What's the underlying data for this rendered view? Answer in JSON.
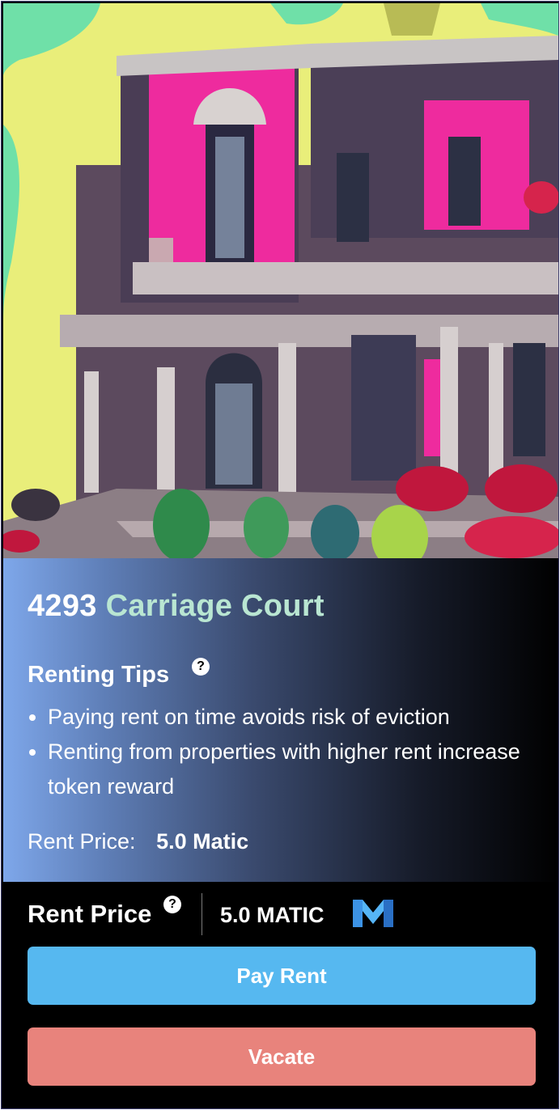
{
  "property": {
    "address_number": "4293",
    "address_street": "Carriage Court",
    "image_icon": "victorian-house-illustration"
  },
  "tips": {
    "title": "Renting Tips",
    "help_glyph": "?",
    "items": [
      "Paying rent on time avoids risk of eviction",
      "Renting from properties with higher rent increase token reward"
    ]
  },
  "summary": {
    "price_label": "Rent Price:",
    "price_value": "5.0 Matic"
  },
  "action_bar": {
    "rent_label": "Rent Price",
    "help_glyph": "?",
    "amount": "5.0 MATIC",
    "token_icon": "matic-logo-icon"
  },
  "buttons": {
    "pay_rent": "Pay Rent",
    "vacate": "Vacate"
  },
  "colors": {
    "pay_button": "#56b8f0",
    "vacate_button": "#e8837c",
    "street_name": "#b9e6d2",
    "matic_logo": "#3f8fe0"
  }
}
